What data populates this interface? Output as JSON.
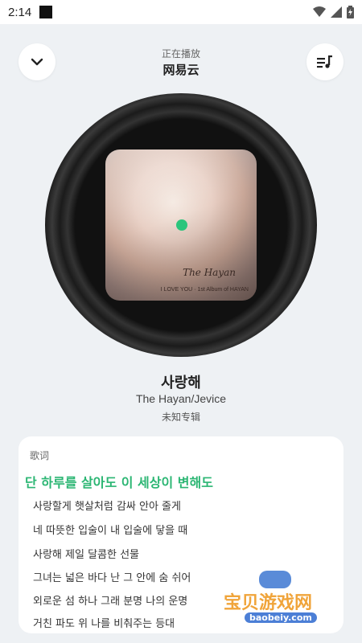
{
  "status_bar": {
    "time": "2:14",
    "icons": [
      "app-square-icon",
      "wifi-icon",
      "signal-icon",
      "battery-icon"
    ]
  },
  "header": {
    "subtitle": "正在播放",
    "source": "网易云",
    "left_icon": "chevron-down-icon",
    "right_icon": "playlist-icon"
  },
  "cover": {
    "text_main": "The Hayan",
    "text_small": "I LOVE YOU · 1st Album of HAYAN"
  },
  "song": {
    "title": "사랑해",
    "artist": "The Hayan/Jevice",
    "album": "未知专辑"
  },
  "lyrics": {
    "header": "歌词",
    "active_line": "단 하루를 살아도 이 세상이 변해도",
    "lines": [
      "사랑할게 햇살처럼 감싸 안아 줄게",
      "네 따뜻한 입술이 내 입술에 닿을 때",
      "사랑해 제일 달콤한 선물",
      "그녀는 넓은 바다 난 그 안에 숨 쉬어",
      "외로운 섬 하나 그래 분명 나의 운명",
      "거친 파도 위 나를 비춰주는 등대"
    ]
  },
  "watermark": {
    "text": "宝贝游戏网",
    "url": "baobeiy.com"
  },
  "colors": {
    "accent_green": "#2bb673",
    "background": "#eef1f4",
    "card": "#ffffff"
  }
}
